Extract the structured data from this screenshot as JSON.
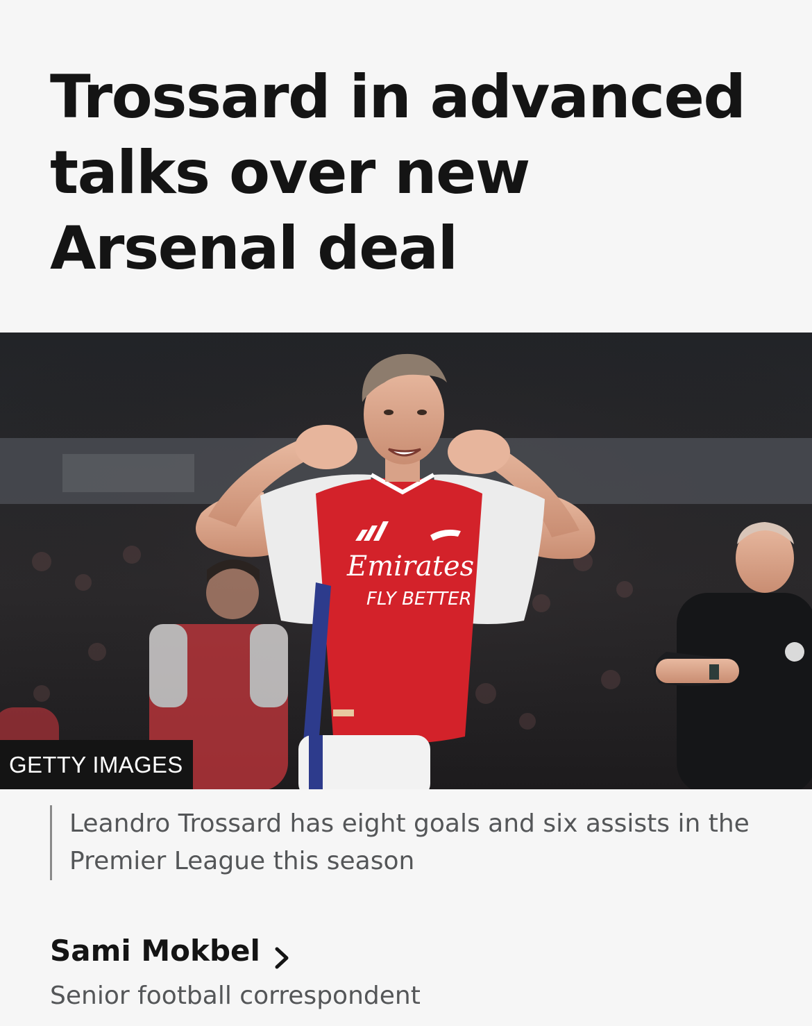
{
  "article": {
    "headline": "Trossard in advanced talks over new Arsenal deal",
    "image": {
      "credit": "GETTY IMAGES",
      "shirt_sponsor_line1": "Emirates",
      "shirt_sponsor_line2": "FLY BETTER"
    },
    "caption": "Leandro Trossard has eight goals and six assists in the Premier League this season",
    "author": {
      "name": "Sami Mokbel",
      "role": "Senior football correspondent",
      "link_icon": "chevron-right-icon"
    }
  },
  "colors": {
    "background": "#f6f6f6",
    "headline": "#141414",
    "caption_text": "#545658",
    "credit_bg": "#141414",
    "kit_red": "#d3222a"
  }
}
